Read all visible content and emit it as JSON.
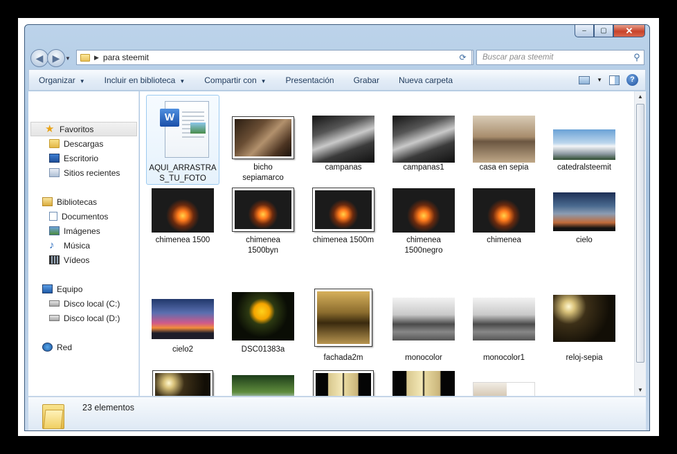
{
  "window": {
    "close_glyph": "✕",
    "max_glyph": "▢",
    "min_glyph": "–"
  },
  "nav": {
    "back_glyph": "◀",
    "forward_glyph": "▶",
    "address_separator": "▶",
    "address_path": "para steemit",
    "address_dropdown": "▼",
    "refresh_glyph": "⟳",
    "search_placeholder": "Buscar para steemit",
    "search_glyph": "⚲"
  },
  "toolbar": {
    "organizar": "Organizar",
    "incluir": "Incluir en biblioteca",
    "compartir": "Compartir con",
    "presentacion": "Presentación",
    "grabar": "Grabar",
    "nueva_carpeta": "Nueva carpeta",
    "caret": "▼",
    "help": "?"
  },
  "sidebar": {
    "favoritos": {
      "label": "Favoritos",
      "icon": "star-icon"
    },
    "favoritos_items": [
      {
        "label": "Descargas",
        "icon": "downloads-folder-icon"
      },
      {
        "label": "Escritorio",
        "icon": "desktop-icon"
      },
      {
        "label": "Sitios recientes",
        "icon": "recent-places-icon"
      }
    ],
    "bibliotecas": {
      "label": "Bibliotecas",
      "icon": "libraries-icon"
    },
    "bibliotecas_items": [
      {
        "label": "Documentos",
        "icon": "documents-icon"
      },
      {
        "label": "Imágenes",
        "icon": "pictures-icon"
      },
      {
        "label": "Música",
        "icon": "music-icon"
      },
      {
        "label": "Vídeos",
        "icon": "videos-icon"
      }
    ],
    "equipo": {
      "label": "Equipo",
      "icon": "computer-icon"
    },
    "equipo_items": [
      {
        "label": "Disco local (C:)",
        "icon": "local-disk-c-icon"
      },
      {
        "label": "Disco local (D:)",
        "icon": "local-disk-d-icon"
      }
    ],
    "red": {
      "label": "Red",
      "icon": "network-icon"
    }
  },
  "files": [
    {
      "name": "AQUI_ARRASTRAS_TU_FOTO",
      "type": "word-document",
      "label_lines": [
        "AQUI_ARRASTRA",
        "S_TU_FOTO"
      ]
    },
    {
      "name": "bicho sepiamarco",
      "label_lines": [
        "bicho",
        "sepiamarco"
      ]
    },
    {
      "name": "campanas",
      "label_lines": [
        "campanas"
      ]
    },
    {
      "name": "campanas1",
      "label_lines": [
        "campanas1"
      ]
    },
    {
      "name": "casa en sepia",
      "label_lines": [
        "casa en sepia"
      ]
    },
    {
      "name": "catedralsteemit",
      "label_lines": [
        "catedralsteemit"
      ]
    },
    {
      "name": "chimenea 1500",
      "label_lines": [
        "chimenea 1500"
      ]
    },
    {
      "name": "chimenea 1500byn",
      "label_lines": [
        "chimenea",
        "1500byn"
      ]
    },
    {
      "name": "chimenea 1500m",
      "label_lines": [
        "chimenea 1500m"
      ]
    },
    {
      "name": "chimenea 1500negro",
      "label_lines": [
        "chimenea",
        "1500negro"
      ]
    },
    {
      "name": "chimenea",
      "label_lines": [
        "chimenea"
      ]
    },
    {
      "name": "cielo",
      "label_lines": [
        "cielo"
      ]
    },
    {
      "name": "cielo2",
      "label_lines": [
        "cielo2"
      ]
    },
    {
      "name": "DSC01383a",
      "label_lines": [
        "DSC01383a"
      ]
    },
    {
      "name": "fachada2m",
      "label_lines": [
        "fachada2m"
      ]
    },
    {
      "name": "monocolor",
      "label_lines": [
        "monocolor"
      ]
    },
    {
      "name": "monocolor1",
      "label_lines": [
        "monocolor1"
      ]
    },
    {
      "name": "reloj-sepia",
      "label_lines": [
        "reloj-sepia"
      ]
    },
    {
      "name": "",
      "label_lines": []
    },
    {
      "name": "",
      "label_lines": []
    },
    {
      "name": "",
      "label_lines": []
    },
    {
      "name": "",
      "label_lines": []
    },
    {
      "name": "",
      "label_lines": []
    }
  ],
  "status": {
    "count_text": "23 elementos"
  },
  "scrollbar": {
    "up": "▲",
    "down": "▼"
  }
}
